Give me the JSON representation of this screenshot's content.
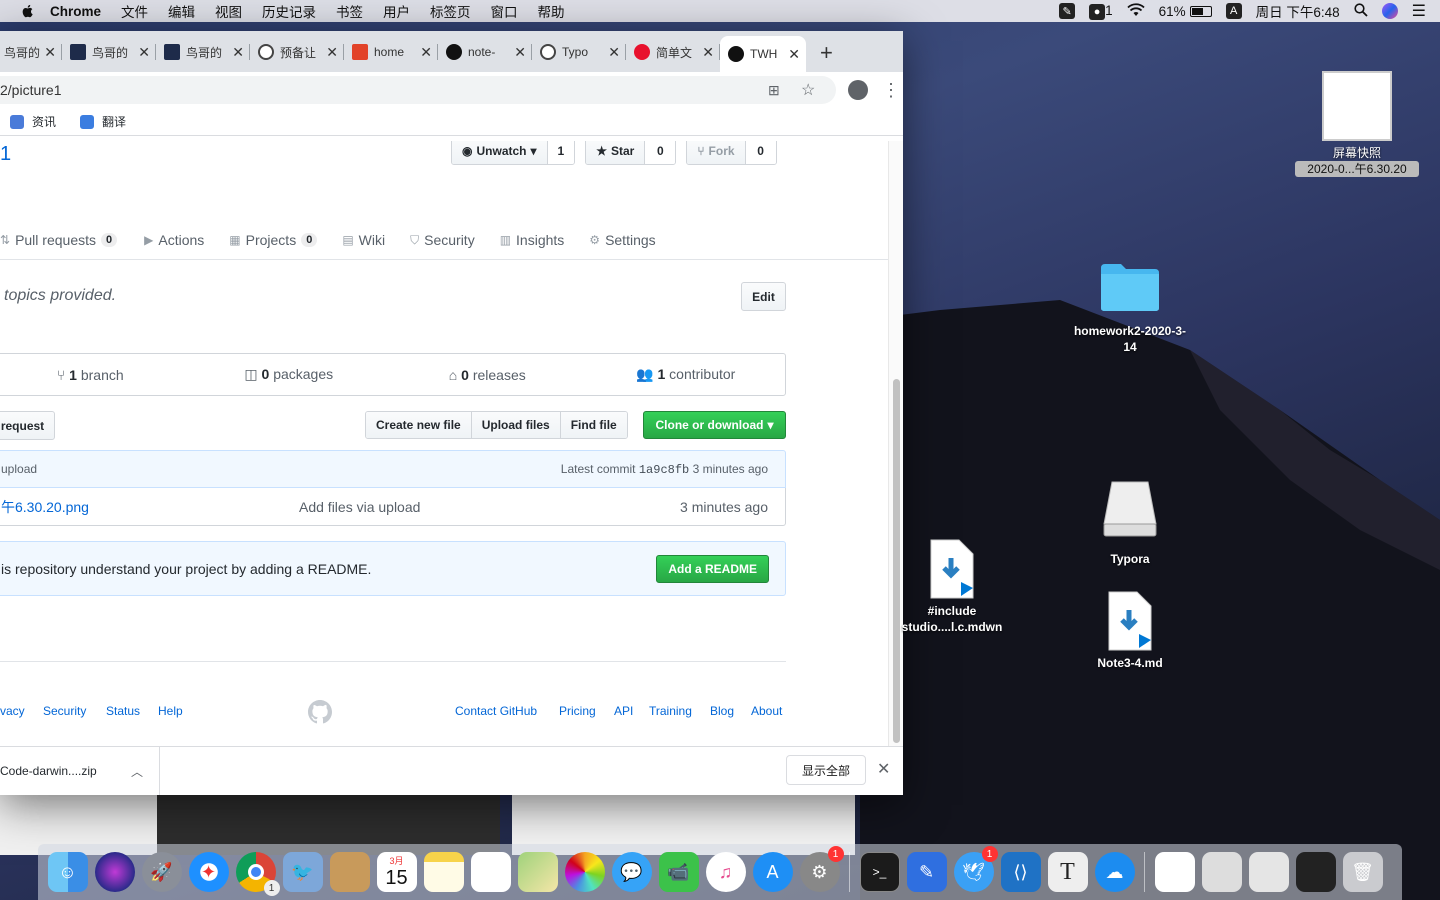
{
  "menubar": {
    "app_name": "Chrome",
    "items": [
      "文件",
      "编辑",
      "视图",
      "历史记录",
      "书签",
      "用户",
      "标签页",
      "窗口",
      "帮助"
    ],
    "battery": "61%",
    "clock": "周日 下午6:48",
    "input_method": "A",
    "status_num": "1"
  },
  "tabs": [
    {
      "title": "鸟哥的",
      "favicon": "bird-favicon"
    },
    {
      "title": "鸟哥的",
      "favicon": "bird-favicon"
    },
    {
      "title": "鸟哥的",
      "favicon": "bird-favicon"
    },
    {
      "title": "预备让",
      "favicon": "globe-favicon"
    },
    {
      "title": "home",
      "favicon": "gitlab-favicon"
    },
    {
      "title": "note-",
      "favicon": "github-favicon"
    },
    {
      "title": "Typo",
      "favicon": "globe-favicon"
    },
    {
      "title": "简单文",
      "favicon": "red-favicon"
    },
    {
      "title": "TWH",
      "favicon": "github-favicon",
      "active": true
    }
  ],
  "omnibox": {
    "url": "2/picture1"
  },
  "bookmarks": [
    {
      "label": "资讯",
      "color": "#4a7bd9"
    },
    {
      "label": "翻译",
      "color": "#3b7de0"
    }
  ],
  "repo": {
    "title": "1",
    "watch": {
      "label": "Unwatch",
      "count": "1"
    },
    "star": {
      "label": "Star",
      "count": "0"
    },
    "fork": {
      "label": "Fork",
      "count": "0"
    },
    "nav": {
      "pulls": {
        "label": "Pull requests",
        "count": "0"
      },
      "actions": {
        "label": "Actions"
      },
      "projects": {
        "label": "Projects",
        "count": "0"
      },
      "wiki": {
        "label": "Wiki"
      },
      "security": {
        "label": "Security"
      },
      "insights": {
        "label": "Insights"
      },
      "settings": {
        "label": "Settings"
      }
    },
    "description": "topics provided.",
    "edit_label": "Edit",
    "summary": {
      "branch_n": "1",
      "branch_t": "branch",
      "packages_n": "0",
      "packages_t": "packages",
      "releases_n": "0",
      "releases_t": "releases",
      "contrib_n": "1",
      "contrib_t": "contributor"
    },
    "pr_button": "request",
    "file_buttons": {
      "create": "Create new file",
      "upload": "Upload files",
      "find": "Find file"
    },
    "clone_label": "Clone or download",
    "commit": {
      "message": "upload",
      "latest": "Latest commit",
      "sha": "1a9c8fb",
      "when": "3 minutes ago"
    },
    "files": [
      {
        "name": "午6.30.20.png",
        "message": "Add files via upload",
        "age": "3 minutes ago"
      }
    ],
    "readme_text": "is repository understand your project by adding a README.",
    "readme_button": "Add a README"
  },
  "footer": {
    "left": [
      "vacy",
      "Security",
      "Status",
      "Help"
    ],
    "right": [
      "Contact GitHub",
      "Pricing",
      "API",
      "Training",
      "Blog",
      "About"
    ]
  },
  "downloads": {
    "file": "Code-darwin....zip",
    "show_all": "显示全部"
  },
  "desktop": {
    "screenshot": {
      "line1": "屏幕快照",
      "line2": "2020-0...午6.30.20"
    },
    "folder": {
      "label": "homework2-2020-3-14"
    },
    "typora": {
      "label": "Typora"
    },
    "include_file": {
      "label": "#include studio....l.c.mdwn"
    },
    "note": {
      "label": "Note3-4.md"
    }
  },
  "dock": {
    "calendar_month": "3月",
    "calendar_day": "15",
    "badges": {
      "system_prefs": "1",
      "bird_app": "1",
      "chrome": "1"
    },
    "apps": [
      "finder-icon",
      "siri-icon",
      "launchpad-icon",
      "safari-icon",
      "chrome-icon",
      "preview-icon",
      "contacts-icon",
      "calendar-icon",
      "notes-icon",
      "reminders-icon",
      "maps-icon",
      "photos-icon",
      "messages-icon",
      "facetime-icon",
      "itunes-icon",
      "appstore-icon",
      "system-preferences-icon",
      "terminal-icon",
      "pen-icon",
      "bird-icon",
      "vscode-icon",
      "typora-icon",
      "cloud-icon",
      "document-icon",
      "screenshot1-icon",
      "screenshot2-icon",
      "screenshot3-icon",
      "trash-icon"
    ]
  }
}
